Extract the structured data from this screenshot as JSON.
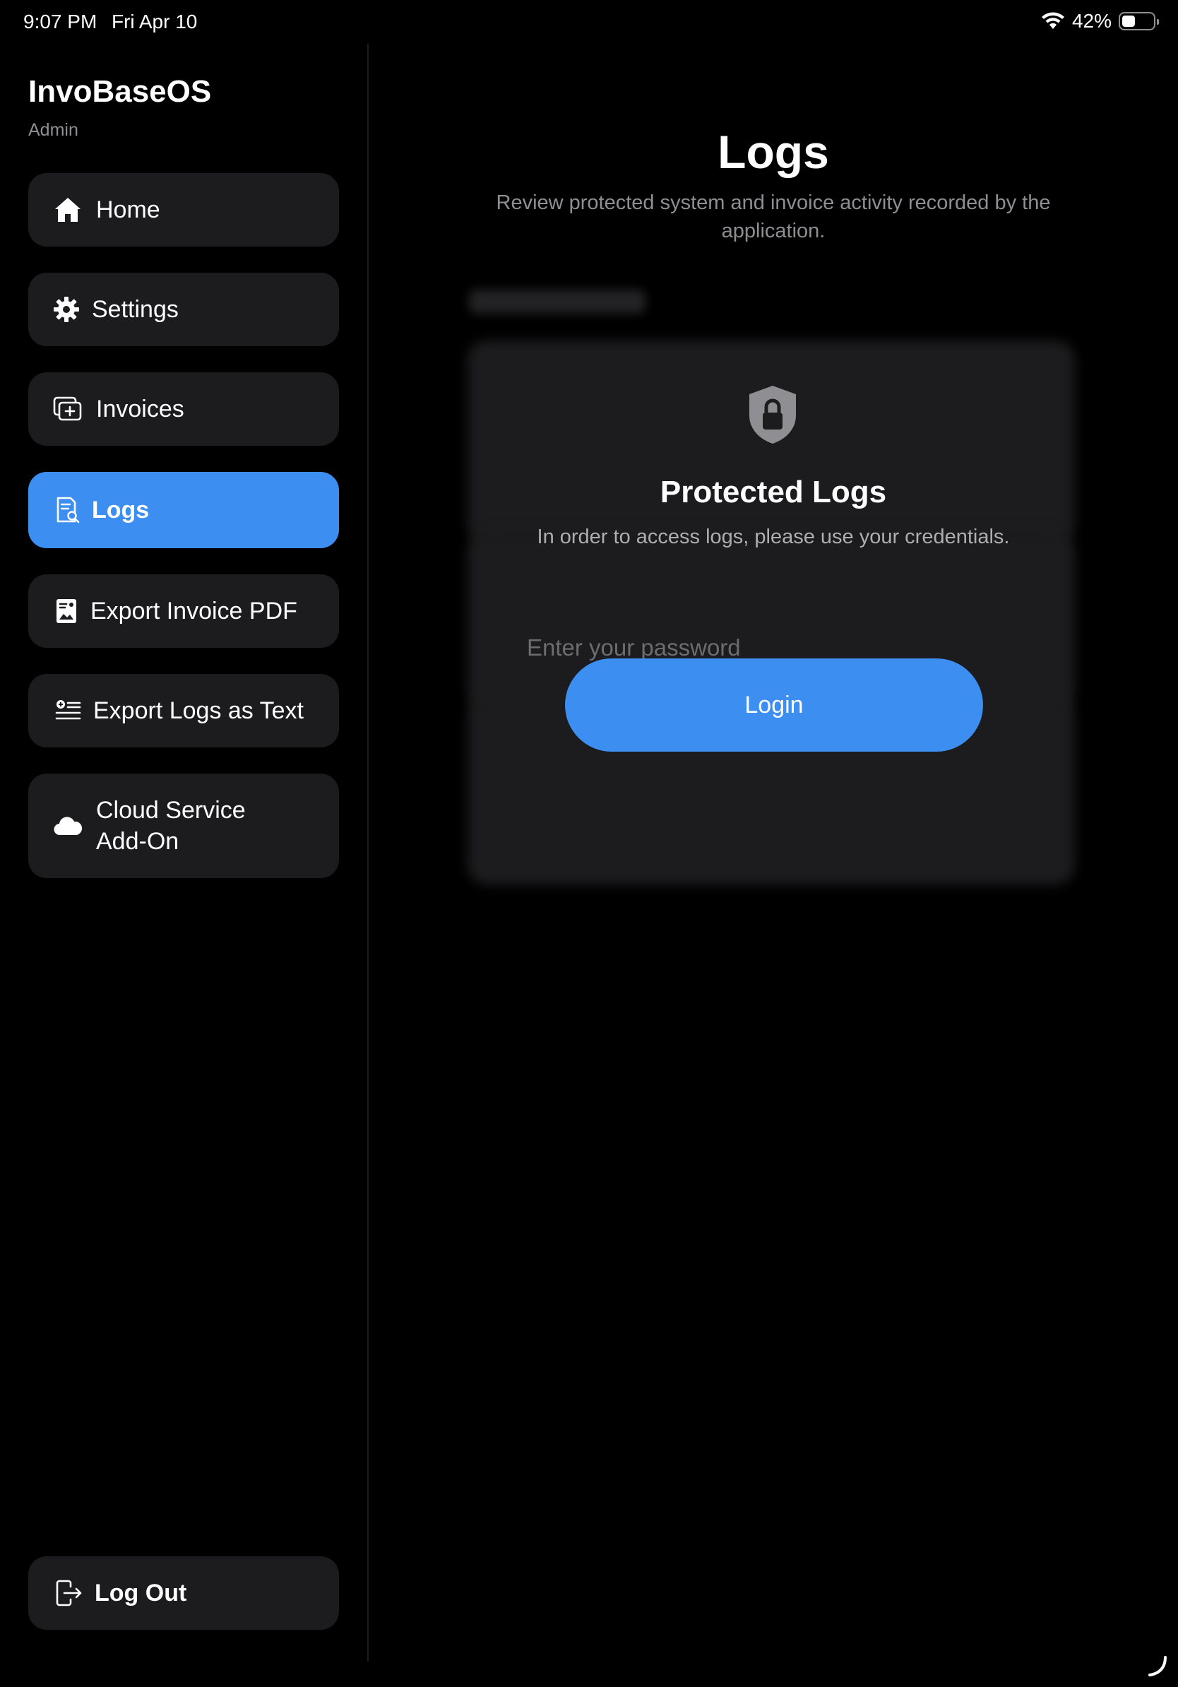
{
  "status_bar": {
    "time": "9:07 PM",
    "date": "Fri Apr 10",
    "battery_percent": "42%",
    "battery_level": 0.42
  },
  "sidebar": {
    "app_title": "InvoBaseOS",
    "app_subtitle": "Admin",
    "items": [
      {
        "label": "Home",
        "icon": "house-icon",
        "active": false
      },
      {
        "label": "Settings",
        "icon": "gear-icon",
        "active": false
      },
      {
        "label": "Invoices",
        "icon": "invoices-add-icon",
        "active": false
      },
      {
        "label": "Logs",
        "icon": "document-search-icon",
        "active": true
      },
      {
        "label": "Export Invoice PDF",
        "icon": "document-image-icon",
        "active": false
      },
      {
        "label": "Export Logs as Text",
        "icon": "list-export-icon",
        "active": false
      },
      {
        "label": "Cloud Service Add-On",
        "icon": "cloud-icon",
        "active": false
      }
    ],
    "logout_label": "Log Out"
  },
  "main": {
    "title": "Logs",
    "subtitle": "Review protected system and invoice activity recorded by the application.",
    "lock": {
      "title": "Protected Logs",
      "description": "In order to access logs, please use your credentials.",
      "password_placeholder": "Enter your password",
      "login_label": "Login"
    }
  },
  "colors": {
    "accent": "#3d8ef1",
    "background": "#000000",
    "card": "#1c1c1e",
    "secondary_text": "#8e8e93"
  }
}
